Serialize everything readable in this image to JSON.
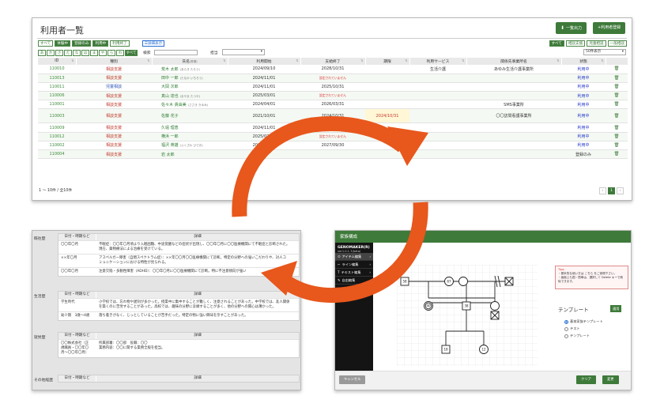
{
  "list": {
    "title": "利用者一覧",
    "btn_export": "一覧出力",
    "btn_register": "+利用者登録",
    "status_filters": [
      "すべて",
      "体験中",
      "登録のみ",
      "利用中",
      "利用終了"
    ],
    "detail_btn": "詳細表示",
    "right_filters": [
      "すべて",
      "相談支援",
      "児童相談",
      "一般相談"
    ],
    "kana": [
      "あ",
      "か",
      "さ",
      "た",
      "な",
      "は",
      "ま",
      "や",
      "ら",
      "わ",
      "すべて"
    ],
    "search_label": "検索",
    "staff_label": "担当",
    "per_page": "50件表示",
    "columns": [
      "ID",
      "種別",
      "氏名",
      "利用開始",
      "支給終了",
      "期限",
      "利用サービス",
      "関係先事業所名",
      "状態",
      ""
    ],
    "name_sort_hint": "(昇順)",
    "rows": [
      {
        "id": "110010",
        "type": "相談支援",
        "name": "荒木 太郎",
        "sub": "(あらき たろう)",
        "start": "2024/09/10",
        "end": "2028/10/31",
        "limit": "",
        "service": "生活介護",
        "office": "あゆみ生活介護事業所",
        "status": "利用中"
      },
      {
        "id": "110013",
        "type": "相談支援",
        "name": "田中 一郎",
        "sub": "(たなか いちろう)",
        "start": "2024/11/01",
        "end": "設定されていません",
        "limit": "",
        "service": "",
        "office": "",
        "status": "利用中"
      },
      {
        "id": "110011",
        "type": "児童相談",
        "name": "大岡 次郎",
        "sub": "",
        "start": "2024/11/01",
        "end": "2025/10/31",
        "limit": "",
        "service": "",
        "office": "",
        "status": "利用中"
      },
      {
        "id": "110006",
        "type": "相談支援",
        "name": "真山 達也",
        "sub": "(まやま たつや)",
        "start": "2025/03/01",
        "end": "設定されていません",
        "limit": "",
        "service": "",
        "office": "",
        "status": "利用中"
      },
      {
        "id": "110001",
        "type": "相談支援",
        "name": "佐々木 貴由美",
        "sub": "(ささき きゆみ)",
        "start": "2024/04/01",
        "end": "2026/03/31",
        "limit": "",
        "service": "",
        "office": "SMS事業所",
        "status": "利用中"
      },
      {
        "id": "110003",
        "type": "相談支援",
        "name": "佐藤 花子",
        "sub": "",
        "start": "2021/10/01",
        "end": "2024/10/31",
        "limit": "2024/10/31",
        "service": "",
        "office": "〇〇訪問看護事業所",
        "status": "利用中"
      },
      {
        "id": "110009",
        "type": "相談支援",
        "name": "久堀 理恵",
        "sub": "",
        "start": "2024/11/01",
        "end": "2026/10/31",
        "limit": "",
        "service": "",
        "office": "",
        "status": "利用中"
      },
      {
        "id": "110012",
        "type": "相談支援",
        "name": "横浜 一郎",
        "sub": "",
        "start": "2025/02/01",
        "end": "設定されていません",
        "limit": "",
        "service": "",
        "office": "",
        "status": "利用中"
      },
      {
        "id": "110002",
        "type": "相談支援",
        "name": "福沢 英雄",
        "sub": "(ふくざわ ひでお)",
        "start": "2024/10/01",
        "end": "2027/09/30",
        "limit": "",
        "service": "",
        "office": "",
        "status": "利用中"
      },
      {
        "id": "110004",
        "type": "相談支援",
        "name": "岩 太郎",
        "sub": "",
        "start": "",
        "end": "",
        "limit": "",
        "service": "",
        "office": "",
        "status": "登録のみ"
      }
    ],
    "footer": "1 〜 10件 / 全10件",
    "pager": [
      "‹",
      "1",
      "›"
    ]
  },
  "history": {
    "col_date": "日付・時期など",
    "col_detail": "詳細",
    "sections": [
      {
        "label": "既往歴",
        "rows": [
          {
            "date": "〇〇年〇月",
            "text": "不眠症：〇〇年〇月頃より入眠困難、中途覚醒などの症状が出現し、〇〇年〇月に〇〇医療機関にて不眠症と診断された。\n現在、薬物療法による治療を受けている。"
          },
          {
            "date": "××年〇月",
            "text": "アスペルガー障害（自閉スペクトラム症）：××年〇〇月〇〇医療機関にて診断。特定の分野への強いこだわりや、対人コ\nミュニケーションにおける特性が見られる。"
          },
          {
            "date": "〇〇年〇月",
            "text": "注意欠陥・多動性障害（ADHD）：〇〇年〇月に〇〇医療機関にて診断。特に不注意傾向が強い"
          }
        ]
      },
      {
        "label": "生活歴",
        "rows": [
          {
            "date": "学生時代",
            "text": "小学校では、忘れ物や遅刻が多かった。授業中に集中することが難しく、注意されることがあった。中学校では、友人関係\nを築くのに苦労することがあった。高校では、趣味の分野に没頭することが多く、他の分野への関心は薄かった。"
          },
          {
            "date": "幼少期　3歳〜4歳",
            "text": "落ち着きがなく、じっとしていることが苦手だった。特定の物に強い興味を示すことがあった。"
          }
        ]
      },
      {
        "label": "就労歴",
        "rows": [
          {
            "date": "〇〇株式会社（正\n規職員・〇〇年〇\n月〜〇〇年〇月）",
            "text": "所属部署：〇〇部　役職：〇〇\n業務内容：〇〇に関する業務全般を担当。"
          }
        ]
      },
      {
        "label": "その他経歴",
        "rows": []
      }
    ]
  },
  "genogram": {
    "title": "家族構成",
    "app": "GENOMAKER(R)",
    "version": "ver1.0.1.7(beta)",
    "tools": [
      {
        "label": "アイテム編集",
        "icon": "edit-icon"
      },
      {
        "label": "ライン編集",
        "icon": "line-icon"
      },
      {
        "label": "テキスト編集",
        "icon": "text-icon"
      },
      {
        "label": "自由編集",
        "icon": "free-icon"
      }
    ],
    "tips_title": "Tips:",
    "tips_lines": [
      "・基本的な使い方は こちら をご参照下さい。",
      "・画面上も図・簡単は、選択して Delete キーで削除できます。"
    ],
    "nodes": [
      "58",
      "67",
      "38",
      "40",
      "18",
      "12"
    ],
    "template_label": "テンプレート",
    "template_apply": "適用",
    "template_options": [
      "基本家族テンプレート",
      "テスト",
      "テンプレート"
    ],
    "btn_cancel": "キャンセル",
    "btn_clear": "クリア",
    "btn_change": "変更"
  },
  "colors": {
    "accent_green": "#3e7a3a",
    "arrow_orange": "#e8571c"
  }
}
